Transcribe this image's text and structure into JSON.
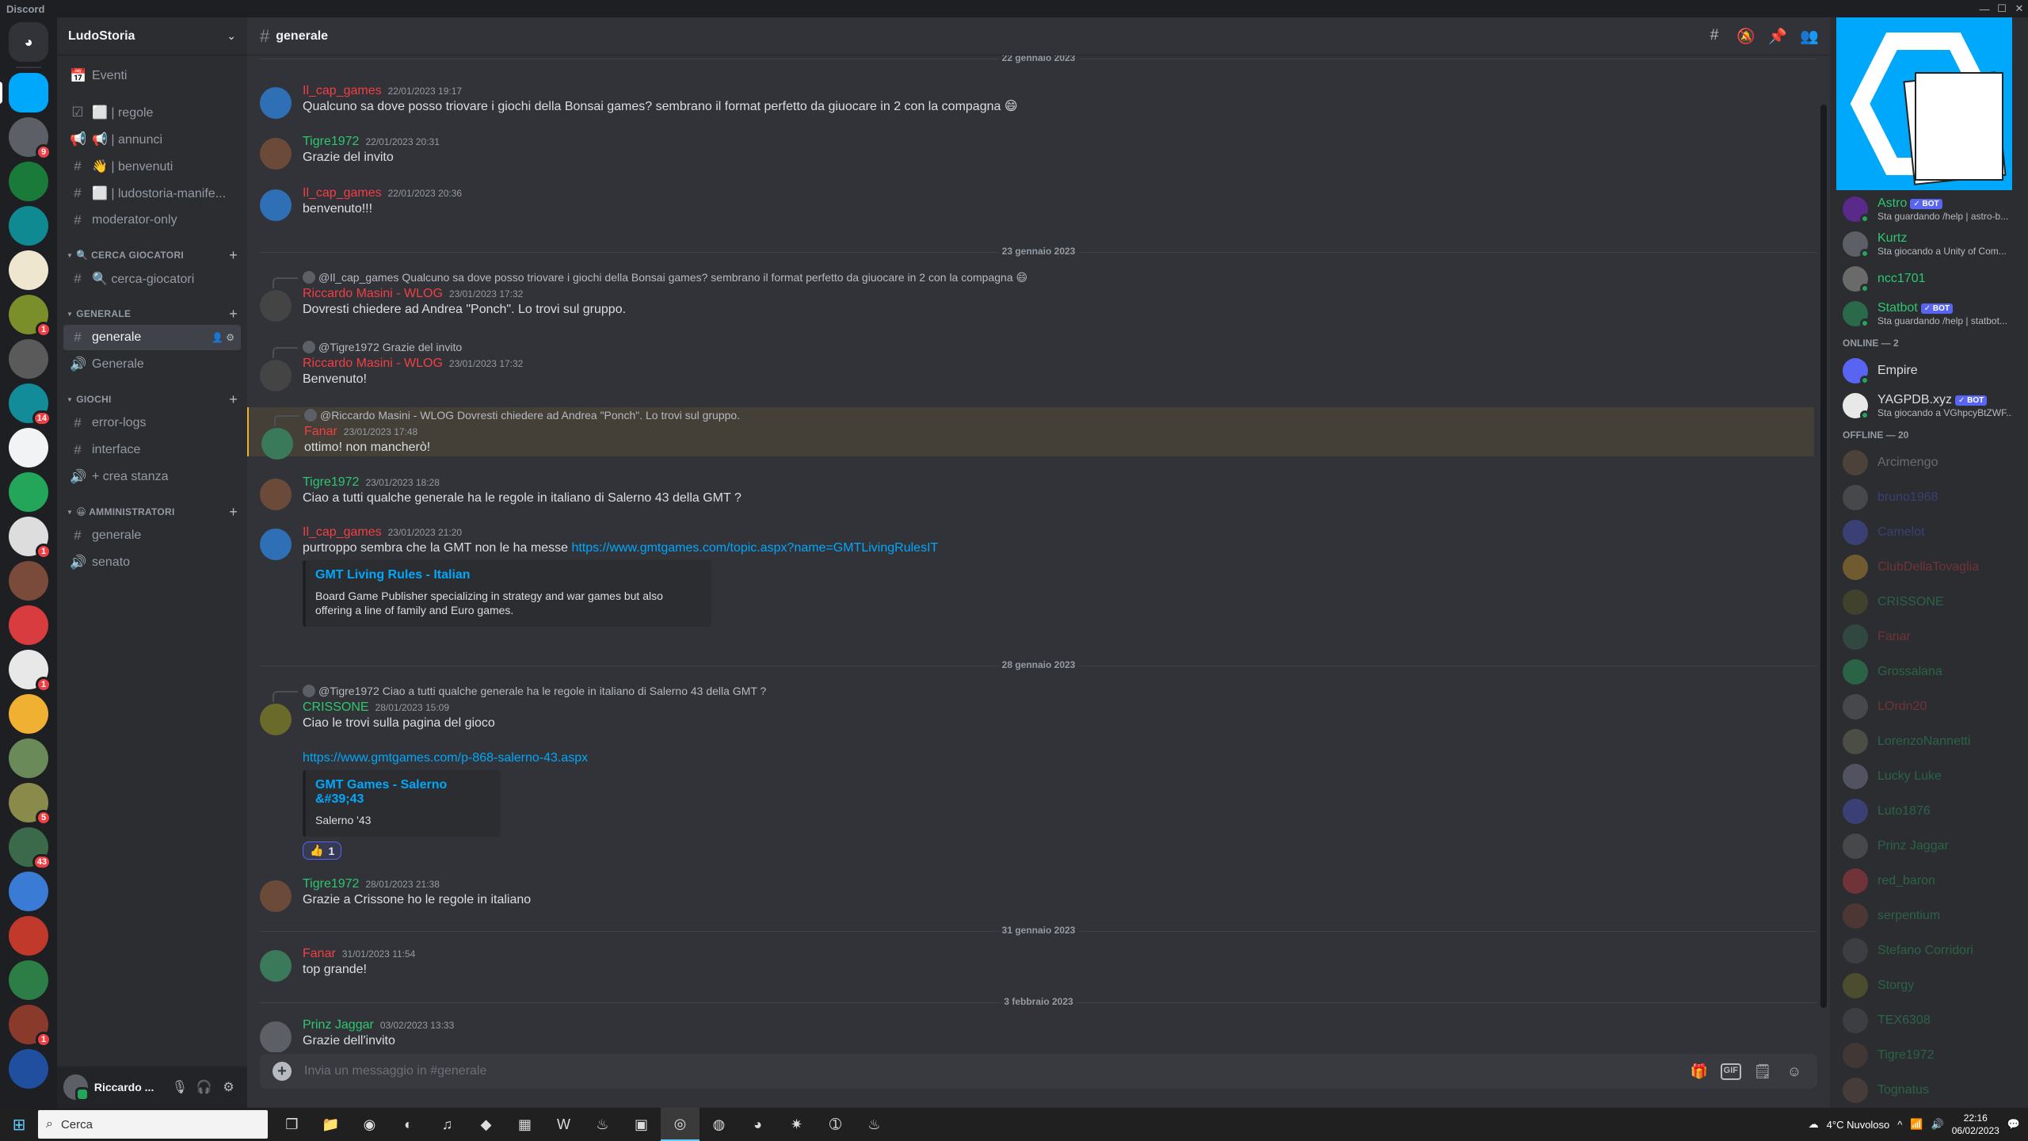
{
  "window": {
    "app_name": "Discord"
  },
  "server_rail": {
    "servers": [
      {
        "name": "home",
        "color": "#313338"
      },
      {
        "name": "LudoStoria",
        "color": "#00a8fc",
        "active": true
      },
      {
        "name": "server-3",
        "color": "#5c5f66",
        "badge": "9"
      },
      {
        "name": "server-4",
        "color": "#1a7a3a"
      },
      {
        "name": "server-5",
        "color": "#0f8a93"
      },
      {
        "name": "server-6",
        "color": "#efe6d0"
      },
      {
        "name": "server-7",
        "color": "#7a8f2a",
        "badge": "1"
      },
      {
        "name": "server-8",
        "color": "#5a5a5a"
      },
      {
        "name": "server-9",
        "color": "#138c9a",
        "badge": "14"
      },
      {
        "name": "server-10",
        "color": "#f2f3f5"
      },
      {
        "name": "server-11",
        "color": "#23a55a"
      },
      {
        "name": "server-12",
        "color": "#dddddd",
        "badge": "1"
      },
      {
        "name": "server-13",
        "color": "#7a4a3a"
      },
      {
        "name": "server-14",
        "color": "#d83c3e"
      },
      {
        "name": "server-15",
        "color": "#e8e8e8",
        "badge": "1"
      },
      {
        "name": "server-16",
        "color": "#f0b132"
      },
      {
        "name": "server-17",
        "color": "#6a8a5a"
      },
      {
        "name": "server-18",
        "color": "#8a8a4a",
        "badge": "5"
      },
      {
        "name": "server-19",
        "color": "#3a6a4a",
        "badge": "43"
      },
      {
        "name": "server-20",
        "color": "#3a7bd5"
      },
      {
        "name": "server-21",
        "color": "#c0392b"
      },
      {
        "name": "server-22",
        "color": "#2d7d46"
      },
      {
        "name": "server-23",
        "color": "#8a3a2a",
        "badge": "1"
      },
      {
        "name": "server-24",
        "color": "#1f4f9e"
      }
    ]
  },
  "guild": {
    "name": "LudoStoria",
    "events_label": "Eventi",
    "top_channels": [
      {
        "icon": "☑",
        "label": "⬜ | regole"
      },
      {
        "icon": "📢",
        "label": "📢 | annunci"
      },
      {
        "icon": "#",
        "label": "👋 | benvenuti"
      },
      {
        "icon": "#",
        "label": "⬜ | ludostoria-manife..."
      },
      {
        "icon": "#",
        "label": "moderator-only"
      }
    ],
    "categories": [
      {
        "name": "🔍 CERCA GIOCATORI",
        "channels": [
          {
            "icon": "#",
            "label": "🔍 cerca-giocatori"
          }
        ]
      },
      {
        "name": "GENERALE",
        "channels": [
          {
            "icon": "#",
            "label": "generale",
            "active": true
          },
          {
            "icon": "🔊",
            "label": "Generale"
          }
        ]
      },
      {
        "name": "GIOCHI",
        "channels": [
          {
            "icon": "#",
            "label": "error-logs"
          },
          {
            "icon": "#",
            "label": "interface"
          },
          {
            "icon": "🔊",
            "label": "+ crea stanza"
          }
        ]
      },
      {
        "name": "😀 AMMINISTRATORI",
        "channels": [
          {
            "icon": "#",
            "label": "generale"
          },
          {
            "icon": "🔊",
            "label": "senato"
          }
        ]
      }
    ]
  },
  "user_panel": {
    "name": "Riccardo ..."
  },
  "channel": {
    "name": "generale"
  },
  "dividers": [
    "22 gennaio 2023",
    "23 gennaio 2023",
    "28 gennaio 2023",
    "31 gennaio 2023",
    "3 febbraio 2023"
  ],
  "messages": [
    {
      "author": "Il_cap_games",
      "color": "#f23f43",
      "ts": "22/01/2023 19:17",
      "text": "Qualcuno sa dove posso triovare i giochi della Bonsai games? sembrano il format perfetto da giuocare in 2 con la compagna 😄",
      "av": "#2f6fb5"
    },
    {
      "author": "Tigre1972",
      "color": "#2dc770",
      "ts": "22/01/2023 20:31",
      "text": "Grazie del invito",
      "av": "#6b4a3a"
    },
    {
      "author": "Il_cap_games",
      "color": "#f23f43",
      "ts": "22/01/2023 20:36",
      "text": "benvenuto!!!",
      "av": "#2f6fb5"
    },
    {
      "reply_name": "@Il_cap_games",
      "reply_text": "Qualcuno sa dove posso triovare i giochi della Bonsai games? sembrano il format perfetto da giuocare in 2 con la compagna 😄",
      "author": "Riccardo Masini - WLOG",
      "color": "#f23f43",
      "ts": "23/01/2023 17:32",
      "text": "Dovresti chiedere ad Andrea \"Ponch\". Lo trovi sul gruppo.",
      "av": "#444"
    },
    {
      "reply_name": "@Tigre1972",
      "reply_text": "Grazie del invito",
      "author": "Riccardo Masini - WLOG",
      "color": "#f23f43",
      "ts": "23/01/2023 17:32",
      "text": "Benvenuto!",
      "av": "#444"
    },
    {
      "reply_name": "@Riccardo Masini - WLOG",
      "reply_text": "Dovresti chiedere ad Andrea \"Ponch\". Lo trovi sul gruppo.",
      "author": "Fanar",
      "color": "#f23f43",
      "ts": "23/01/2023 17:48",
      "text": "ottimo! non mancherò!",
      "av": "#3a7a5a"
    },
    {
      "author": "Tigre1972",
      "color": "#2dc770",
      "ts": "23/01/2023 18:28",
      "text": "Ciao a tutti  qualche generale ha le regole in italiano di Salerno 43 della GMT ?",
      "av": "#6b4a3a"
    },
    {
      "author": "Il_cap_games",
      "color": "#f23f43",
      "ts": "23/01/2023 21:20",
      "text": "purtroppo sembra che la GMT non le ha messe ",
      "link": "https://www.gmtgames.com/topic.aspx?name=GMTLivingRulesIT",
      "embed_title": "GMT Living Rules - Italian",
      "embed_desc": "Board Game Publisher specializing in strategy and war games but also offering a line of family and Euro games.",
      "av": "#2f6fb5"
    },
    {
      "reply_name": "@Tigre1972",
      "reply_text": "Ciao a tutti qualche generale ha le regole in italiano di Salerno 43 della GMT ?",
      "author": "CRISSONE",
      "color": "#2dc770",
      "ts": "28/01/2023 15:09",
      "text": "Ciao le trovi sulla pagina del gioco",
      "link": "https://www.gmtgames.com/p-868-salerno-43.aspx",
      "embed_title": "GMT Games - Salerno &#39;43",
      "embed_desc": "Salerno '43",
      "reaction": "👍",
      "reaction_count": "1",
      "av": "#6a6a2a"
    },
    {
      "author": "Tigre1972",
      "color": "#2dc770",
      "ts": "28/01/2023 21:38",
      "text": "Grazie a Crissone ho le regole in italiano",
      "av": "#6b4a3a"
    },
    {
      "author": "Fanar",
      "color": "#f23f43",
      "ts": "31/01/2023 11:54",
      "text": "top grande!",
      "av": "#3a7a5a"
    },
    {
      "author": "Prinz Jaggar",
      "color": "#2dc770",
      "ts": "03/02/2023 13:33",
      "text": "Grazie dell'invito",
      "av": "#5c5f66"
    }
  ],
  "composer": {
    "placeholder": "Invia un messaggio in #generale",
    "gif": "GIF"
  },
  "members": {
    "top": [
      {
        "name": "Astro",
        "color": "#2dc770",
        "bot": "✓ BOT",
        "act": "Sta guardando /help | astro-b...",
        "av": "#5a2a8a"
      },
      {
        "name": "Kurtz",
        "color": "#2dc770",
        "act": "Sta giocando a Unity of Com...",
        "av": "#5c5f66"
      },
      {
        "name": "ncc1701",
        "color": "#2dc770",
        "av": "#6a6a6a"
      },
      {
        "name": "Statbot",
        "color": "#2dc770",
        "bot": "✓ BOT",
        "act": "Sta guardando /help | statbot...",
        "av": "#2a6a4a"
      }
    ],
    "online_label": "ONLINE — 2",
    "online": [
      {
        "name": "Empire",
        "color": "#dbdee1",
        "av": "#5865f2"
      },
      {
        "name": "YAGPDB.xyz",
        "color": "#dbdee1",
        "bot": "✓ BOT",
        "act": "Sta giocando a VGhpcyBtZWF...",
        "av": "#e8e8e8"
      }
    ],
    "offline_label": "OFFLINE — 20",
    "offline": [
      {
        "name": "Arcimengo",
        "color": "#dbdee1",
        "av": "#8a6a4a"
      },
      {
        "name": "bruno1968",
        "color": "#5865f2",
        "av": "#7a7a7a"
      },
      {
        "name": "Camelot",
        "color": "#5865f2",
        "av": "#5865f2"
      },
      {
        "name": "ClubDellaTovaglia",
        "color": "#f23f43",
        "av": "#f0b132"
      },
      {
        "name": "CRISSONE",
        "color": "#2dc770",
        "av": "#6a6a2a"
      },
      {
        "name": "Fanar",
        "color": "#f23f43",
        "av": "#3a7a5a"
      },
      {
        "name": "Grossalana",
        "color": "#2dc770",
        "av": "#2dc770"
      },
      {
        "name": "LOrdn20",
        "color": "#f23f43",
        "av": "#7a7a7a"
      },
      {
        "name": "LorenzoNannetti",
        "color": "#2dc770",
        "av": "#8a8a6a"
      },
      {
        "name": "Lucky Luke",
        "color": "#2dc770",
        "av": "#9a9aba"
      },
      {
        "name": "Luto1876",
        "color": "#2dc770",
        "av": "#5865f2"
      },
      {
        "name": "Prinz Jaggar",
        "color": "#2dc770",
        "av": "#7a7a7a"
      },
      {
        "name": "red_baron",
        "color": "#2dc770",
        "av": "#f23f43"
      },
      {
        "name": "serpentium",
        "color": "#2dc770",
        "av": "#8a4a3a"
      },
      {
        "name": "Stefano Corridori",
        "color": "#2dc770",
        "av": "#5c5f66"
      },
      {
        "name": "Storgy",
        "color": "#2dc770",
        "av": "#8a8a2a"
      },
      {
        "name": "TEX6308",
        "color": "#2dc770",
        "av": "#5c5f66"
      },
      {
        "name": "Tigre1972",
        "color": "#2dc770",
        "av": "#6b4a3a"
      },
      {
        "name": "Tognatus",
        "color": "#2dc770",
        "av": "#7a5a4a"
      }
    ]
  },
  "taskbar": {
    "search_placeholder": "Cerca",
    "weather": "4°C  Nuvoloso",
    "time": "22:16",
    "date": "06/02/2023"
  }
}
